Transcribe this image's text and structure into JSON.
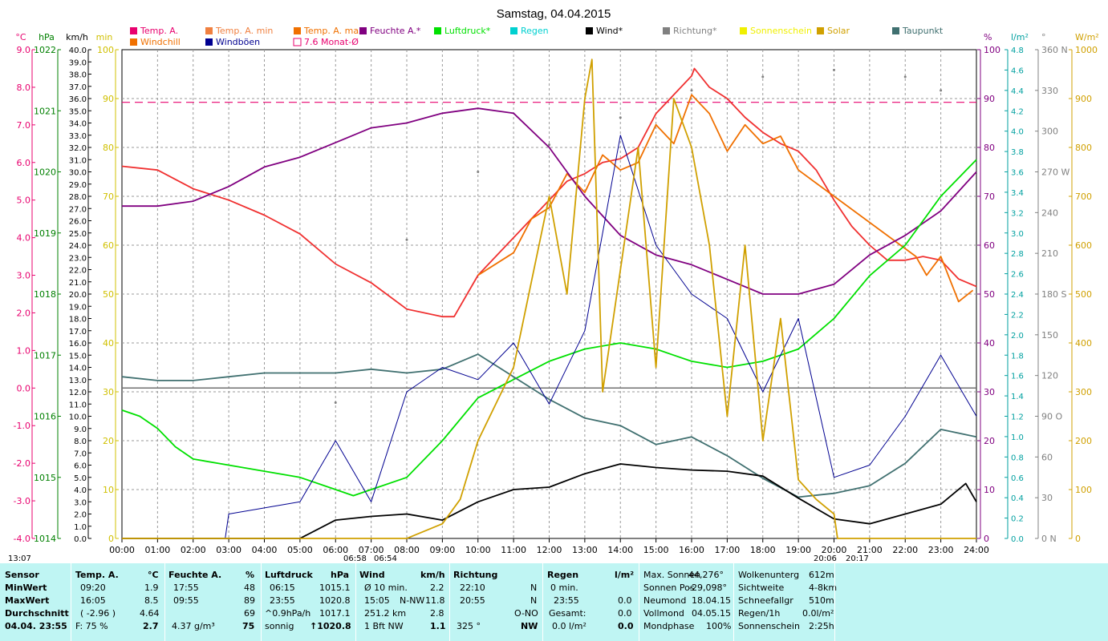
{
  "chart_data": {
    "type": "line",
    "title": "Samstag, 04.04.2015",
    "x_ticks": [
      "00:00",
      "01:00",
      "02:00",
      "03:00",
      "04:00",
      "05:00",
      "06:00",
      "07:00",
      "08:00",
      "09:00",
      "10:00",
      "11:00",
      "12:00",
      "13:00",
      "14:00",
      "15:00",
      "16:00",
      "17:00",
      "18:00",
      "19:00",
      "20:00",
      "21:00",
      "22:00",
      "23:00",
      "24:00"
    ],
    "legend": [
      {
        "name": "Temp. A.",
        "color": "#e8006e",
        "type": "square"
      },
      {
        "name": "Temp. A. min",
        "color": "#f08040",
        "type": "square"
      },
      {
        "name": "Temp. A. max",
        "color": "#f07000",
        "type": "square"
      },
      {
        "name": "Feuchte A.*",
        "color": "#800080",
        "type": "square"
      },
      {
        "name": "Luftdruck*",
        "color": "#00e000",
        "type": "square"
      },
      {
        "name": "Regen",
        "color": "#00d0d0",
        "type": "square"
      },
      {
        "name": "Wind*",
        "color": "#000000",
        "type": "square"
      },
      {
        "name": "Richtung*",
        "color": "#808080",
        "type": "square"
      },
      {
        "name": "Sonnenschein",
        "color": "#f0f000",
        "type": "square"
      },
      {
        "name": "Solar",
        "color": "#d0a000",
        "type": "square"
      },
      {
        "name": "Taupunkt",
        "color": "#407070",
        "type": "square"
      },
      {
        "name": "Windchill",
        "color": "#f07000",
        "type": "square"
      },
      {
        "name": "Windböen",
        "color": "#000090",
        "type": "square"
      },
      {
        "name": "7.6 Monat-Ø",
        "color": "#e8006e",
        "type": "outline"
      }
    ],
    "axes_left": [
      {
        "unit": "°C",
        "color": "#e8006e",
        "ticks": [
          "9.0",
          "8.0",
          "7.0",
          "6.0",
          "5.0",
          "4.0",
          "3.0",
          "2.0",
          "1.0",
          "0.0",
          "-1.0",
          "-2.0",
          "-3.0",
          "-4.0"
        ],
        "range": [
          -4,
          9
        ]
      },
      {
        "unit": "hPa",
        "color": "#008000",
        "ticks": [
          "1022",
          "1021",
          "1020",
          "1019",
          "1018",
          "1017",
          "1016",
          "1015",
          "1014"
        ],
        "range": [
          1014,
          1022
        ]
      },
      {
        "unit": "km/h",
        "color": "#000000",
        "ticks": [
          "40.0",
          "39.0",
          "38.0",
          "37.0",
          "36.0",
          "35.0",
          "34.0",
          "33.0",
          "32.0",
          "31.0",
          "30.0",
          "29.0",
          "28.0",
          "27.0",
          "26.0",
          "25.0",
          "24.0",
          "23.0",
          "22.0",
          "21.0",
          "20.0",
          "19.0",
          "18.0",
          "17.0",
          "16.0",
          "15.0",
          "14.0",
          "13.0",
          "12.0",
          "11.0",
          "10.0",
          "9.0",
          "8.0",
          "7.0",
          "6.0",
          "5.0",
          "4.0",
          "3.0",
          "2.0",
          "1.0",
          "0.0"
        ],
        "range": [
          0,
          40
        ]
      },
      {
        "unit": "min",
        "color": "#d0c000",
        "ticks": [
          "100",
          "90",
          "80",
          "70",
          "60",
          "50",
          "40",
          "30",
          "20",
          "10",
          "0"
        ],
        "range": [
          0,
          100
        ]
      }
    ],
    "axes_right": [
      {
        "unit": "%",
        "color": "#800080",
        "ticks": [
          "100",
          "90",
          "80",
          "70",
          "60",
          "50",
          "40",
          "30",
          "20",
          "10",
          "0"
        ],
        "range": [
          0,
          100
        ]
      },
      {
        "unit": "l/m²",
        "color": "#00a0a0",
        "ticks": [
          "4.8",
          "4.6",
          "4.4",
          "4.2",
          "4.0",
          "3.8",
          "3.6",
          "3.4",
          "3.2",
          "3.0",
          "2.8",
          "2.6",
          "2.4",
          "2.2",
          "2.0",
          "1.8",
          "1.6",
          "1.4",
          "1.2",
          "1.0",
          "0.8",
          "0.6",
          "0.4",
          "0.2",
          "0.0"
        ],
        "range": [
          0,
          5
        ]
      },
      {
        "unit": "°",
        "color": "#808080",
        "ticks": [
          "360 N",
          "330",
          "300",
          "270 W",
          "240",
          "210",
          "180 S",
          "150",
          "120",
          "90  O",
          "60",
          "30",
          "0  N"
        ],
        "range": [
          0,
          360
        ]
      },
      {
        "unit": "W/m²",
        "color": "#d0a000",
        "ticks": [
          "1000",
          "900",
          "800",
          "700",
          "600",
          "500",
          "400",
          "300",
          "200",
          "100",
          "0"
        ],
        "range": [
          0,
          1000
        ]
      }
    ],
    "series": [
      {
        "name": "Temp. A.",
        "unit": "°C",
        "color": "#f03030",
        "x": [
          0,
          1,
          2,
          3,
          4,
          5,
          6,
          7,
          8,
          9,
          9.33,
          10,
          11,
          12,
          12.5,
          13,
          13.5,
          14,
          14.5,
          15,
          15.5,
          16,
          16.08,
          16.5,
          17,
          17.5,
          18,
          18.5,
          19,
          19.5,
          20,
          20.5,
          21,
          21.5,
          22,
          22.5,
          23,
          23.5,
          24
        ],
        "y": [
          5.9,
          5.8,
          5.3,
          5.0,
          4.6,
          4.1,
          3.3,
          2.8,
          2.1,
          1.9,
          1.9,
          3.0,
          4.0,
          5.0,
          5.5,
          5.7,
          6.0,
          6.1,
          6.4,
          7.3,
          7.8,
          8.3,
          8.5,
          8.0,
          7.7,
          7.2,
          6.8,
          6.5,
          6.3,
          5.8,
          5.0,
          4.3,
          3.8,
          3.4,
          3.4,
          3.5,
          3.4,
          2.9,
          2.7
        ]
      },
      {
        "name": "Temp. A. max",
        "unit": "°C",
        "color": "#f07000",
        "x": [
          10,
          11,
          11.5,
          12,
          12.5,
          13,
          13.5,
          14,
          14.5,
          15,
          15.5,
          16,
          16.5,
          17,
          17.5,
          18,
          18.5,
          19,
          22.3,
          22.6,
          23,
          23.5,
          23.9
        ],
        "y": [
          3.0,
          3.6,
          4.5,
          4.8,
          5.7,
          5.2,
          6.2,
          5.8,
          6.0,
          7.0,
          6.5,
          7.8,
          7.3,
          6.3,
          7.0,
          6.5,
          6.7,
          5.8,
          3.5,
          3.0,
          3.5,
          2.3,
          2.6
        ]
      },
      {
        "name": "Feuchte A.*",
        "unit": "%",
        "color": "#800080",
        "x": [
          0,
          1,
          2,
          3,
          4,
          5,
          6,
          7,
          8,
          9,
          10,
          11,
          12,
          13,
          14,
          15,
          16,
          17,
          18,
          19,
          20,
          21,
          22,
          23,
          24
        ],
        "y": [
          68,
          68,
          69,
          72,
          76,
          78,
          81,
          84,
          85,
          87,
          88,
          87,
          80,
          70,
          62,
          58,
          56,
          53,
          50,
          50,
          52,
          58,
          62,
          67,
          75
        ]
      },
      {
        "name": "Luftdruck*",
        "unit": "hPa",
        "color": "#00e000",
        "x": [
          0,
          0.5,
          1,
          1.5,
          2,
          3,
          4,
          5,
          6,
          6.5,
          7,
          8,
          9,
          10,
          11,
          12,
          13,
          14,
          15,
          15.5,
          16,
          17,
          18,
          19,
          20,
          21,
          22,
          23,
          24
        ],
        "y": [
          1016.1,
          1016.0,
          1015.8,
          1015.5,
          1015.3,
          1015.2,
          1015.1,
          1015.0,
          1014.8,
          1014.7,
          1014.8,
          1015.0,
          1015.6,
          1016.3,
          1016.6,
          1016.9,
          1017.1,
          1017.2,
          1017.1,
          1017.0,
          1016.9,
          1016.8,
          1016.9,
          1017.1,
          1017.6,
          1018.3,
          1018.8,
          1019.6,
          1020.2
        ]
      },
      {
        "name": "Taupunkt",
        "unit": "°C",
        "color": "#407070",
        "x": [
          0,
          1,
          2,
          3,
          4,
          5,
          6,
          7,
          8,
          9,
          10,
          11,
          12,
          13,
          14,
          15,
          16,
          17,
          18,
          19,
          20,
          21,
          22,
          23,
          24
        ],
        "y": [
          0.3,
          0.2,
          0.2,
          0.3,
          0.4,
          0.4,
          0.4,
          0.5,
          0.4,
          0.5,
          0.9,
          0.3,
          -0.3,
          -0.8,
          -1.0,
          -1.5,
          -1.3,
          -1.8,
          -2.4,
          -2.9,
          -2.8,
          -2.6,
          -2.0,
          -1.1,
          -1.3
        ]
      },
      {
        "name": "Wind*",
        "unit": "km/h",
        "color": "#000000",
        "x": [
          0,
          1,
          2,
          3,
          4,
          5,
          6,
          7,
          8,
          9,
          10,
          11,
          12,
          13,
          14,
          15,
          16,
          17,
          18,
          19,
          20,
          21,
          22,
          23,
          23.7,
          24
        ],
        "y": [
          0,
          0,
          0,
          0,
          0,
          0,
          1.5,
          1.8,
          2.0,
          1.5,
          3.0,
          4.0,
          4.2,
          5.3,
          6.1,
          5.8,
          5.6,
          5.5,
          5.1,
          3.3,
          1.6,
          1.2,
          2.0,
          2.8,
          4.5,
          3.0
        ]
      },
      {
        "name": "Windböen",
        "unit": "km/h",
        "color": "#000090",
        "x": [
          0,
          2.9,
          3,
          4,
          5,
          6,
          7,
          8,
          9,
          10,
          11,
          12,
          13,
          14,
          15,
          16,
          17,
          18,
          19,
          20,
          21,
          22,
          23,
          24
        ],
        "y": [
          0,
          0,
          2.0,
          2.5,
          3.0,
          8.0,
          3.0,
          12.0,
          14.0,
          13.0,
          16.0,
          11.0,
          17.0,
          33.0,
          24.0,
          20.0,
          18.0,
          12.0,
          18.0,
          5.0,
          6.0,
          10.0,
          15.0,
          10.0
        ]
      },
      {
        "name": "Solar",
        "unit": "W/m²",
        "color": "#d0a000",
        "x": [
          0,
          8,
          9,
          9.5,
          10,
          11,
          12,
          12.5,
          13,
          13.2,
          13.5,
          14,
          14.5,
          15,
          15.5,
          16,
          16.5,
          17,
          17.5,
          18,
          18.5,
          19,
          19.5,
          20,
          20.1,
          24
        ],
        "y": [
          0,
          0,
          30,
          80,
          200,
          350,
          700,
          500,
          900,
          980,
          300,
          550,
          800,
          350,
          900,
          800,
          600,
          250,
          600,
          200,
          450,
          120,
          80,
          50,
          0,
          0
        ]
      },
      {
        "name": "Richtung*",
        "unit": "°",
        "color": "#808080",
        "x": [
          6,
          8,
          10,
          12,
          14,
          16,
          18,
          20,
          22,
          23
        ],
        "y": [
          100,
          220,
          270,
          290,
          310,
          330,
          340,
          345,
          340,
          330
        ]
      }
    ],
    "monthly_avg_temp": 7.6
  },
  "stats": {
    "sensor": {
      "h": "Sensor",
      "min": "MinWert",
      "max": "MaxWert",
      "avg": "Durchschnitt",
      "date": "04.04. 23:55"
    },
    "temp": {
      "h": "Temp. A.",
      "unit": "°C",
      "min_time": "09:20",
      "min": "1.9",
      "max_time": "16:05",
      "max": "8.5",
      "avg_label": "( -2.96 )",
      "avg": "4.64",
      "f_label": "F: 75 %",
      "f": "2.7"
    },
    "feuchte": {
      "h": "Feuchte A.",
      "unit": "%",
      "min_time": "17:55",
      "min": "48",
      "max_time": "09:55",
      "max": "89",
      "avg": "69",
      "abs": "4.37 g/m³",
      "cur": "75"
    },
    "luftdruck": {
      "h": "Luftdruck",
      "unit": "hPa",
      "min_time": "06:15",
      "min": "1015.1",
      "max_time": "23:55",
      "max": "1020.8",
      "trend": "^0.9hPa/h",
      "avg": "1017.1",
      "wetter": "sonnig",
      "cur": "↑1020.8"
    },
    "wind": {
      "h": "Wind",
      "unit": "km/h",
      "r1_label": "Ø 10 min.",
      "r1": "2.2",
      "r2_time": "15:05",
      "r2_dir": "N-NW",
      "r2": "11.8",
      "r3_label": "251.2 km",
      "r3": "2.8",
      "bft": "1 Bft NW",
      "cur": "1.1"
    },
    "richtung": {
      "h": "Richtung",
      "r1_time": "22:10",
      "r1": "N",
      "r2_time": "20:55",
      "r2": "N",
      "r3": "O-NO",
      "deg": "325 °",
      "cur": "NW"
    },
    "regen": {
      "h": "Regen",
      "unit": "l/m²",
      "r1": "0 min.",
      "r2_time": "23:55",
      "r2": "0.0",
      "r3_label": "Gesamt:",
      "r3": "0.0",
      "r4_label": "0.0 l/m²",
      "r4": "0.0"
    },
    "astro": [
      {
        "l": "Max. Sonnen",
        "v": "44,276°"
      },
      {
        "l": "Sonnen Pos",
        "v": "-29,098°"
      },
      {
        "l": "Neumond",
        "v": "18.04.15"
      },
      {
        "l": "Vollmond",
        "v": "04.05.15"
      },
      {
        "l": "Mondphase",
        "v": "100%"
      }
    ],
    "wetter": [
      {
        "l": "Wolkenunterg",
        "v": "612m"
      },
      {
        "l": "Sichtweite",
        "v": "4-8km"
      },
      {
        "l": "Schneefallgr",
        "v": "510m"
      },
      {
        "l": "Regen/1h",
        "v": "0.0l/m²"
      },
      {
        "l": "Sonnenschein",
        "v": "2:25h"
      }
    ]
  },
  "chart_marks": {
    "time_left": "13:07",
    "sunrise": "06:58",
    "sunrise2": "06:54",
    "sunset": "20:06",
    "sunset2": "20:17"
  }
}
